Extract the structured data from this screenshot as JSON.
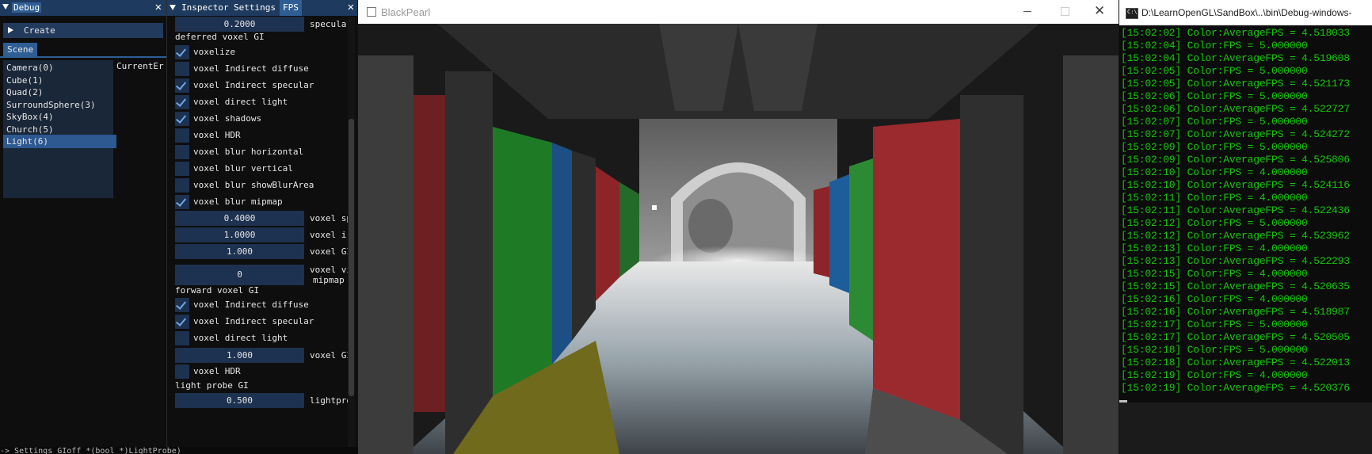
{
  "debug": {
    "title": "Debug",
    "create_label": "Create",
    "tab": "Scene",
    "scene_items": [
      "Camera(0)",
      "Cube(1)",
      "Quad(2)",
      "SurroundSphere(3)",
      "SkyBox(4)",
      "Church(5)",
      "Light(6)"
    ],
    "selected_index": 6,
    "current_label": "CurrentEr"
  },
  "inspector": {
    "tabs": [
      "Inspector",
      "Settings",
      "FPS"
    ],
    "active_tab": "FPS",
    "top_value": "0.2000",
    "top_label": "specular",
    "deferred_header": "deferred voxel GI",
    "deferred_checks": [
      {
        "label": "voxelize",
        "checked": true
      },
      {
        "label": "voxel Indirect diffuse",
        "checked": false
      },
      {
        "label": "voxel Indirect specular",
        "checked": true
      },
      {
        "label": "voxel direct light",
        "checked": true
      },
      {
        "label": "voxel shadows",
        "checked": true
      },
      {
        "label": "voxel HDR",
        "checked": false
      },
      {
        "label": "voxel blur horizontal",
        "checked": false
      },
      {
        "label": "voxel blur vertical",
        "checked": false
      },
      {
        "label": "voxel blur showBlurArea",
        "checked": false
      },
      {
        "label": "voxel blur mipmap",
        "checked": true
      }
    ],
    "deferred_fields": [
      {
        "value": "0.4000",
        "label": "voxel sp"
      },
      {
        "value": "1.0000",
        "label": "voxel ir"
      },
      {
        "value": "1.000",
        "label": "voxel GI"
      },
      {
        "value": "0",
        "label": "voxel vi",
        "label2": "mipmap"
      }
    ],
    "forward_header": "forward voxel GI",
    "forward_checks": [
      {
        "label": "voxel Indirect diffuse",
        "checked": true
      },
      {
        "label": "voxel Indirect specular",
        "checked": true
      },
      {
        "label": "voxel direct light",
        "checked": false
      }
    ],
    "forward_field": {
      "value": "1.000",
      "label": "voxel GI"
    },
    "forward_hdr": {
      "label": "voxel HDR",
      "checked": false
    },
    "probe_header": "light probe GI",
    "probe_field": {
      "value": "0.500",
      "label": "lightpro"
    }
  },
  "bottom_strip_text": "  -> Settings GIoff *(bool *)LightProbe)",
  "blackpearl": {
    "title": "BlackPearl"
  },
  "console": {
    "title": "D:\\LearnOpenGL\\SandBox\\..\\bin\\Debug-windows-",
    "lines": [
      "[15:02:02] Color:AverageFPS = 4.518033",
      "[15:02:04] Color:FPS = 5.000000",
      "[15:02:04] Color:AverageFPS = 4.519608",
      "[15:02:05] Color:FPS = 5.000000",
      "[15:02:05] Color:AverageFPS = 4.521173",
      "[15:02:06] Color:FPS = 5.000000",
      "[15:02:06] Color:AverageFPS = 4.522727",
      "[15:02:07] Color:FPS = 5.000000",
      "[15:02:07] Color:AverageFPS = 4.524272",
      "[15:02:09] Color:FPS = 5.000000",
      "[15:02:09] Color:AverageFPS = 4.525806",
      "[15:02:10] Color:FPS = 4.000000",
      "[15:02:10] Color:AverageFPS = 4.524116",
      "[15:02:11] Color:FPS = 4.000000",
      "[15:02:11] Color:AverageFPS = 4.522436",
      "[15:02:12] Color:FPS = 5.000000",
      "[15:02:12] Color:AverageFPS = 4.523962",
      "[15:02:13] Color:FPS = 4.000000",
      "[15:02:13] Color:AverageFPS = 4.522293",
      "[15:02:15] Color:FPS = 4.000000",
      "[15:02:15] Color:AverageFPS = 4.520635",
      "[15:02:16] Color:FPS = 4.000000",
      "[15:02:16] Color:AverageFPS = 4.518987",
      "[15:02:17] Color:FPS = 5.000000",
      "[15:02:17] Color:AverageFPS = 4.520505",
      "[15:02:18] Color:FPS = 5.000000",
      "[15:02:18] Color:AverageFPS = 4.522013",
      "[15:02:19] Color:FPS = 4.000000",
      "[15:02:19] Color:AverageFPS = 4.520376"
    ]
  },
  "colors": {
    "imgui_title": "#1e3a5f",
    "imgui_active": "#2f5e94",
    "frame_bg": "#1d3150",
    "check_mark": "#6fa6e6",
    "console_text": "#16c60c"
  }
}
